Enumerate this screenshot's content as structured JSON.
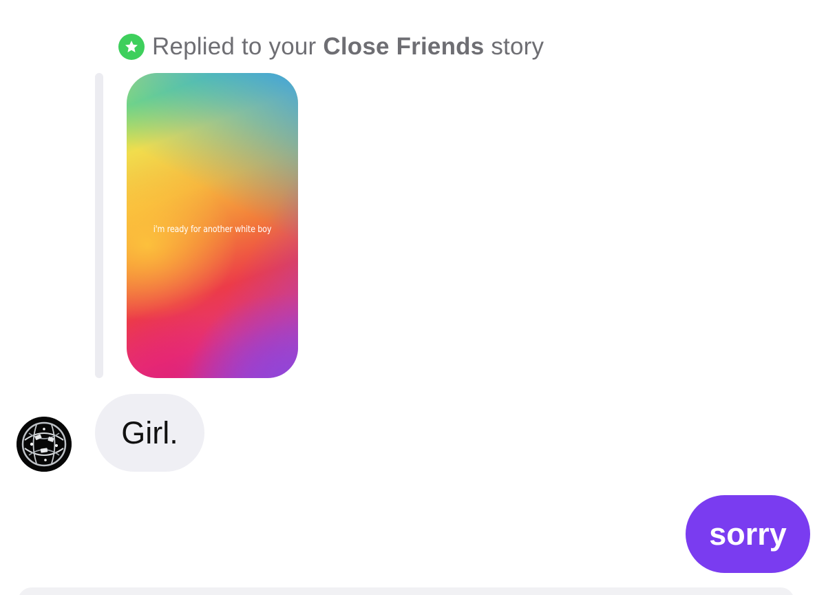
{
  "reply_header": {
    "prefix": "Replied to your",
    "list_name": "Close Friends",
    "suffix": "story",
    "badge_icon": "star-icon",
    "badge_color": "#3ecf5c"
  },
  "story": {
    "text": "i'm ready for another white boy"
  },
  "messages": {
    "received": {
      "text": "Girl.",
      "avatar_icon": "avatar"
    },
    "sent": {
      "text": "sorry",
      "color": "#7a3cf0"
    }
  }
}
